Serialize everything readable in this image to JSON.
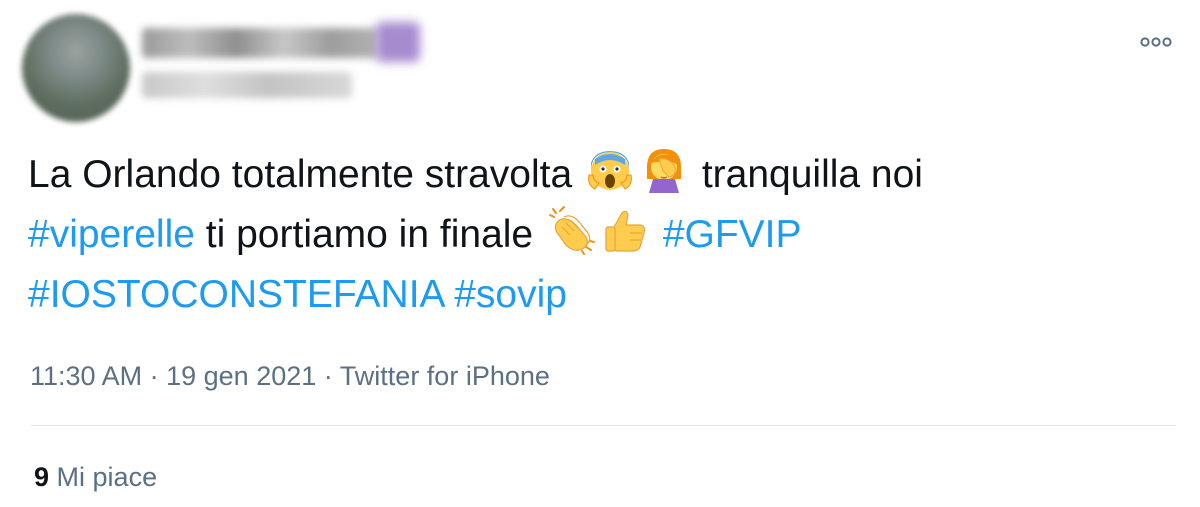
{
  "tweet": {
    "more_icon": "more-options-icon",
    "text": {
      "part1": "La Orlando totalmente stravolta",
      "emoji1": "face-screaming-in-fear-emoji",
      "emoji2": "woman-facepalming-emoji",
      "part2": "tranquilla noi",
      "hashtag1": "#viperelle",
      "part3": "ti portiamo in finale",
      "emoji3": "clapping-hands-emoji",
      "emoji4": "thumbs-up-emoji",
      "hashtag2": "#GFVIP",
      "hashtag3": "#IOSTOCONSTEFANIA",
      "hashtag4": "#sovip"
    },
    "time": "11:30 AM",
    "separator": "·",
    "date": "19 gen 2021",
    "source": "Twitter for iPhone",
    "likes_count": "9",
    "likes_label": "Mi piace",
    "colors": {
      "hashtag": "#1d9bf0",
      "text": "#0f1419",
      "meta": "#5b7083"
    }
  }
}
